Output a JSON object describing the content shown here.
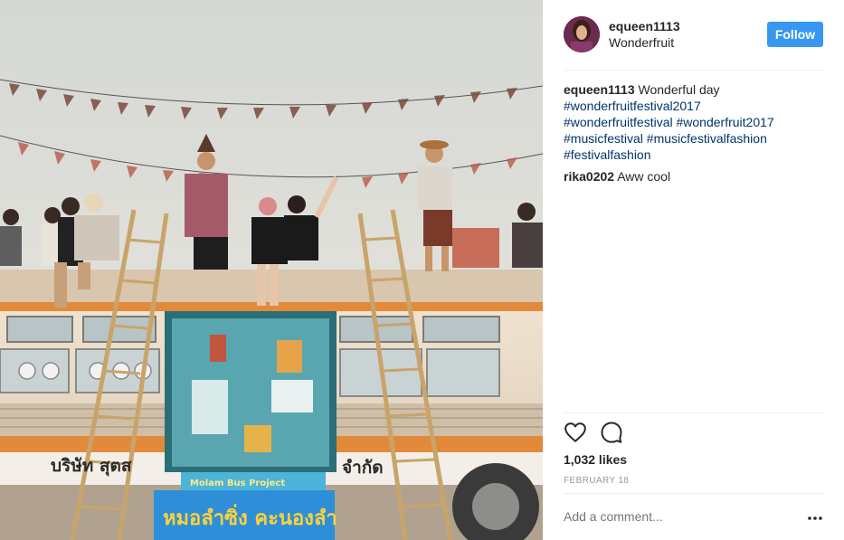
{
  "post": {
    "username": "equeen1113",
    "location": "Wonderfruit",
    "follow_label": "Follow",
    "caption_user": "equeen1113",
    "caption_text": "Wonderful day",
    "hashtags": [
      "#wonderfruitfestival2017",
      "#wonderfruitfestival #wonderfruit2017",
      "#musicfestival #musicfestivalfashion",
      "#festivalfashion"
    ],
    "comment": {
      "user": "rika0202",
      "text": "Aww cool"
    },
    "likes": "1,032 likes",
    "date": "FEBRUARY 18",
    "add_comment_placeholder": "Add a comment..."
  },
  "icons": {
    "like": "heart-icon",
    "comment": "comment-bubble-icon",
    "more": "more-options-icon"
  },
  "photo_text": {
    "bus_sign_left": "บริษัท สุตส",
    "bus_sign_right": "จำกัด",
    "banner_top": "Molam Bus Project",
    "banner_thai": "หมอลำซิ่ง คะนองลำ"
  },
  "colors": {
    "accent": "#3897f0",
    "hashtag": "#003569",
    "muted": "#999999"
  }
}
